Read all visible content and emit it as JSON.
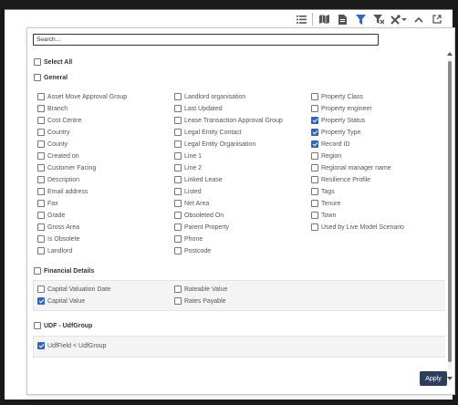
{
  "search": {
    "placeholder": "Search..."
  },
  "select_all": {
    "label": "Select All",
    "checked": false
  },
  "general": {
    "label": "General",
    "columns": [
      [
        {
          "label": "Asset Move Approval Group",
          "checked": false
        },
        {
          "label": "Branch",
          "checked": false
        },
        {
          "label": "Cost Centre",
          "checked": false
        },
        {
          "label": "Country",
          "checked": false
        },
        {
          "label": "County",
          "checked": false
        },
        {
          "label": "Created on",
          "checked": false
        },
        {
          "label": "Customer Facing",
          "checked": false
        },
        {
          "label": "Description",
          "checked": false
        },
        {
          "label": "Email address",
          "checked": false
        },
        {
          "label": "Fax",
          "checked": false
        },
        {
          "label": "Grade",
          "checked": false
        },
        {
          "label": "Gross Area",
          "checked": false
        },
        {
          "label": "Is Obsolete",
          "checked": false
        },
        {
          "label": "Landlord",
          "checked": false
        }
      ],
      [
        {
          "label": "Landlord organisation",
          "checked": false
        },
        {
          "label": "Last Updated",
          "checked": false
        },
        {
          "label": "Lease Transaction Approval Group",
          "checked": false
        },
        {
          "label": "Legal Entity Contact",
          "checked": false
        },
        {
          "label": "Legal Entity Organisation",
          "checked": false
        },
        {
          "label": "Line 1",
          "checked": false
        },
        {
          "label": "Line 2",
          "checked": false
        },
        {
          "label": "Linked Lease",
          "checked": false
        },
        {
          "label": "Listed",
          "checked": false
        },
        {
          "label": "Net Area",
          "checked": false
        },
        {
          "label": "Obsoleted On",
          "checked": false
        },
        {
          "label": "Parent Property",
          "checked": false
        },
        {
          "label": "Phone",
          "checked": false
        },
        {
          "label": "Postcode",
          "checked": false
        }
      ],
      [
        {
          "label": "Property Class",
          "checked": false
        },
        {
          "label": "Property engineer",
          "checked": false
        },
        {
          "label": "Property Status",
          "checked": true
        },
        {
          "label": "Property Type",
          "checked": true
        },
        {
          "label": "Record ID",
          "checked": true
        },
        {
          "label": "Region",
          "checked": false
        },
        {
          "label": "Regional manager name",
          "checked": false
        },
        {
          "label": "Resilience Profile",
          "checked": false
        },
        {
          "label": "Tags",
          "checked": false
        },
        {
          "label": "Tenure",
          "checked": false
        },
        {
          "label": "Town",
          "checked": false
        },
        {
          "label": "Used by Live Model Scenario",
          "checked": false
        }
      ]
    ]
  },
  "financial": {
    "label": "Financial Details",
    "columns": [
      [
        {
          "label": "Capital Valuation Date",
          "checked": false
        },
        {
          "label": "Capital Value",
          "checked": true
        }
      ],
      [
        {
          "label": "Rateable Value",
          "checked": false
        },
        {
          "label": "Rates Payable",
          "checked": false
        }
      ]
    ]
  },
  "udf": {
    "label": "UDF - UdfGroup",
    "columns": [
      [
        {
          "label": "UdfField < UdfGroup",
          "checked": true
        }
      ]
    ]
  },
  "apply_label": "Apply",
  "toolbar": {
    "icons": [
      "list-icon",
      "map-icon",
      "document-icon",
      "filter-icon",
      "clear-filter-icon",
      "tools-icon",
      "collapse-icon",
      "open-external-icon"
    ],
    "active_color": "#2f64c8"
  }
}
